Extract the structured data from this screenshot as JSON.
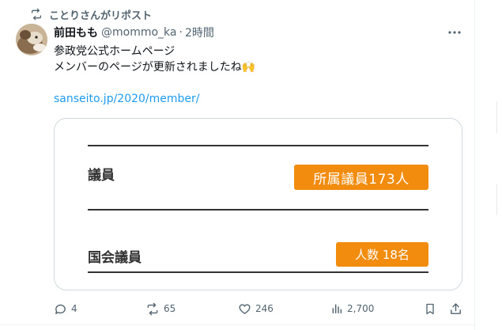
{
  "repost": {
    "icon": "repost-icon",
    "text": "ことりさんがリポスト"
  },
  "author": {
    "name": "前田もも",
    "handle": "@mommo_ka",
    "separator": "·",
    "time": "2時間"
  },
  "more_icon": "more-horizontal-icon",
  "tweet": {
    "line1": "参政党公式ホームページ",
    "line2": "メンバーのページが更新されましたね🙌",
    "link": "sanseito.jp/2020/member/"
  },
  "card": {
    "row1_label": "議員",
    "row1_badge": "所属議員173人",
    "row2_label": "国会議員",
    "row2_badge": "人数 18名",
    "badge_color": "#f28c0f"
  },
  "actions": {
    "replies": "4",
    "reposts": "65",
    "likes": "246",
    "views": "2,700"
  },
  "colors": {
    "text_primary": "#0f1419",
    "text_secondary": "#536471",
    "link": "#1d9bf0",
    "border": "#cfd9de"
  }
}
